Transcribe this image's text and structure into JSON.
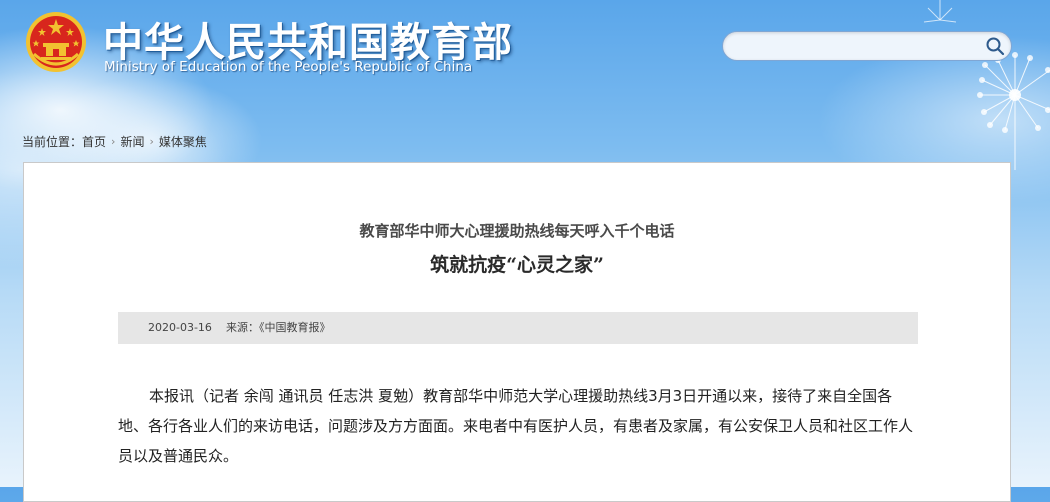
{
  "header": {
    "title_cn": "中华人民共和国教育部",
    "title_en": "Ministry of Education of the People's Republic of China",
    "emblem_icon": "national-emblem-icon",
    "search": {
      "value": "",
      "placeholder": "",
      "button_icon": "search-icon"
    }
  },
  "breadcrumb": {
    "prefix": "当前位置：",
    "items": [
      "首页",
      "新闻",
      "媒体聚焦"
    ],
    "separator_icon": "chevron-right-icon"
  },
  "article": {
    "subtitle": "教育部华中师大心理援助热线每天呼入千个电话",
    "title": "筑就抗疫“心灵之家”",
    "date": "2020-03-16",
    "source": "来源：《中国教育报》",
    "paragraph": "本报讯（记者 余闯 通讯员 任志洪 夏勉）教育部华中师范大学心理援助热线3月3日开通以来，接待了来自全国各地、各行各业人们的来访电话，问题涉及方方面面。来电者中有医护人员，有患者及家属，有公安保卫人员和社区工作人员以及普通民众。"
  },
  "colors": {
    "sky_top": "#5aa6ea",
    "sky_bottom": "#e8f3fc",
    "emblem_red": "#d8261d",
    "emblem_gold": "#f2c230",
    "meta_bar_bg": "#e6e6e6",
    "text": "#222222"
  }
}
